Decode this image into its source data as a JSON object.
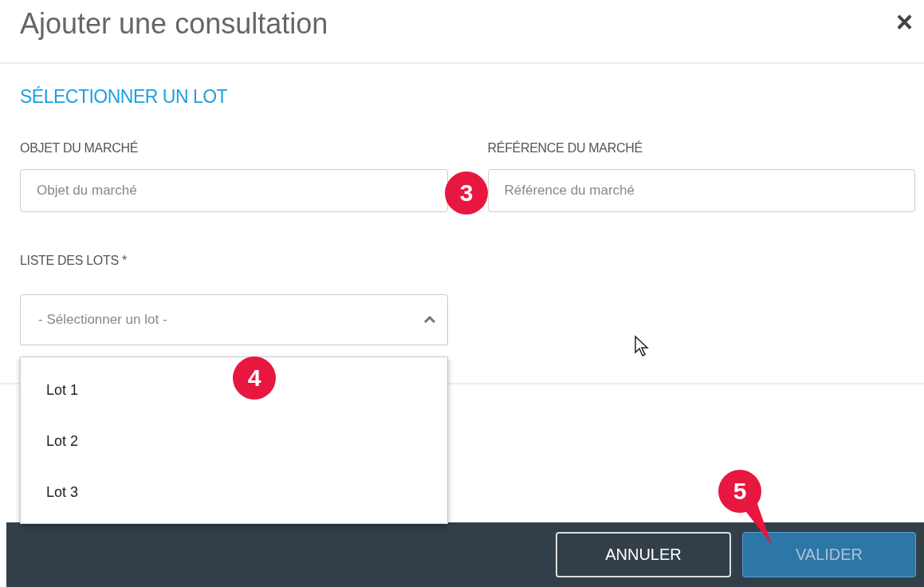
{
  "dialog": {
    "title": "Ajouter une consultation",
    "close": "×"
  },
  "section": {
    "title": "SÉLECTIONNER UN LOT"
  },
  "fields": [
    {
      "label": "OBJET DU MARCHÉ",
      "placeholder": "Objet du marché"
    },
    {
      "label": "RÉFÉRENCE DU MARCHÉ",
      "placeholder": "Référence du marché"
    }
  ],
  "lot_select": {
    "label": "LISTE DES LOTS *",
    "placeholder": "- Sélectionner un lot -",
    "expanded": true,
    "options": [
      {
        "label": "Lot 1",
        "selected": false
      },
      {
        "label": "Lot 2",
        "selected": false
      },
      {
        "label": "Lot 3",
        "selected": false
      }
    ]
  },
  "callouts": [
    {
      "number": "3",
      "kind": "circle"
    },
    {
      "number": "4",
      "kind": "circle"
    },
    {
      "number": "5",
      "kind": "pointer"
    }
  ],
  "buttons": [
    {
      "label": "ANNULER",
      "kind": "secondary",
      "disabled": false
    },
    {
      "label": "VALIDER",
      "kind": "primary",
      "disabled": true
    }
  ]
}
